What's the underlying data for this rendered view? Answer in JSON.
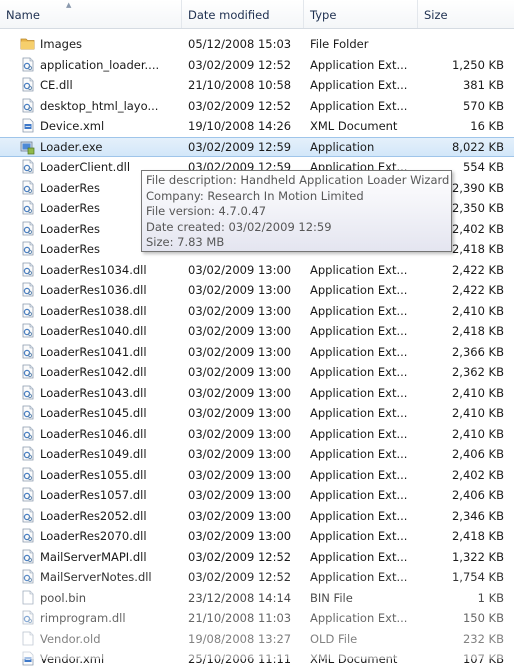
{
  "columns": {
    "name": "Name",
    "date": "Date modified",
    "type": "Type",
    "size": "Size"
  },
  "files": [
    {
      "icon": "folder-icon",
      "name": "Images",
      "date": "05/12/2008 15:03",
      "type": "File Folder",
      "size": ""
    },
    {
      "icon": "dll-icon",
      "name": "application_loader....",
      "date": "03/02/2009 12:52",
      "type": "Application Ext...",
      "size": "1,250 KB"
    },
    {
      "icon": "dll-icon",
      "name": "CE.dll",
      "date": "21/10/2008 10:58",
      "type": "Application Ext...",
      "size": "381 KB"
    },
    {
      "icon": "dll-icon",
      "name": "desktop_html_layo...",
      "date": "03/02/2009 12:52",
      "type": "Application Ext...",
      "size": "570 KB"
    },
    {
      "icon": "xml-icon",
      "name": "Device.xml",
      "date": "19/10/2008 14:26",
      "type": "XML Document",
      "size": "16 KB"
    },
    {
      "icon": "exe-icon",
      "name": "Loader.exe",
      "date": "03/02/2009 12:59",
      "type": "Application",
      "size": "8,022 KB"
    },
    {
      "icon": "dll-icon",
      "name": "LoaderClient.dll",
      "date": "03/02/2009 12:59",
      "type": "Application Ext...",
      "size": "554 KB"
    },
    {
      "icon": "dll-icon",
      "name": "LoaderRes",
      "date": "",
      "type": "",
      "size": "2,390 KB"
    },
    {
      "icon": "dll-icon",
      "name": "LoaderRes",
      "date": "",
      "type": "",
      "size": "2,350 KB"
    },
    {
      "icon": "dll-icon",
      "name": "LoaderRes",
      "date": "",
      "type": "",
      "size": "2,402 KB"
    },
    {
      "icon": "dll-icon",
      "name": "LoaderRes",
      "date": "",
      "type": "",
      "size": "2,418 KB"
    },
    {
      "icon": "dll-icon",
      "name": "LoaderRes1034.dll",
      "date": "03/02/2009 13:00",
      "type": "Application Ext...",
      "size": "2,422 KB"
    },
    {
      "icon": "dll-icon",
      "name": "LoaderRes1036.dll",
      "date": "03/02/2009 13:00",
      "type": "Application Ext...",
      "size": "2,422 KB"
    },
    {
      "icon": "dll-icon",
      "name": "LoaderRes1038.dll",
      "date": "03/02/2009 13:00",
      "type": "Application Ext...",
      "size": "2,410 KB"
    },
    {
      "icon": "dll-icon",
      "name": "LoaderRes1040.dll",
      "date": "03/02/2009 13:00",
      "type": "Application Ext...",
      "size": "2,418 KB"
    },
    {
      "icon": "dll-icon",
      "name": "LoaderRes1041.dll",
      "date": "03/02/2009 13:00",
      "type": "Application Ext...",
      "size": "2,366 KB"
    },
    {
      "icon": "dll-icon",
      "name": "LoaderRes1042.dll",
      "date": "03/02/2009 13:00",
      "type": "Application Ext...",
      "size": "2,362 KB"
    },
    {
      "icon": "dll-icon",
      "name": "LoaderRes1043.dll",
      "date": "03/02/2009 13:00",
      "type": "Application Ext...",
      "size": "2,410 KB"
    },
    {
      "icon": "dll-icon",
      "name": "LoaderRes1045.dll",
      "date": "03/02/2009 13:00",
      "type": "Application Ext...",
      "size": "2,410 KB"
    },
    {
      "icon": "dll-icon",
      "name": "LoaderRes1046.dll",
      "date": "03/02/2009 13:00",
      "type": "Application Ext...",
      "size": "2,410 KB"
    },
    {
      "icon": "dll-icon",
      "name": "LoaderRes1049.dll",
      "date": "03/02/2009 13:00",
      "type": "Application Ext...",
      "size": "2,406 KB"
    },
    {
      "icon": "dll-icon",
      "name": "LoaderRes1055.dll",
      "date": "03/02/2009 13:00",
      "type": "Application Ext...",
      "size": "2,402 KB"
    },
    {
      "icon": "dll-icon",
      "name": "LoaderRes1057.dll",
      "date": "03/02/2009 13:00",
      "type": "Application Ext...",
      "size": "2,406 KB"
    },
    {
      "icon": "dll-icon",
      "name": "LoaderRes2052.dll",
      "date": "03/02/2009 13:00",
      "type": "Application Ext...",
      "size": "2,346 KB"
    },
    {
      "icon": "dll-icon",
      "name": "LoaderRes2070.dll",
      "date": "03/02/2009 13:00",
      "type": "Application Ext...",
      "size": "2,418 KB"
    },
    {
      "icon": "dll-icon",
      "name": "MailServerMAPI.dll",
      "date": "03/02/2009 12:52",
      "type": "Application Ext...",
      "size": "1,322 KB"
    },
    {
      "icon": "dll-icon",
      "name": "MailServerNotes.dll",
      "date": "03/02/2009 12:52",
      "type": "Application Ext...",
      "size": "1,754 KB"
    },
    {
      "icon": "generic-file-icon",
      "name": "pool.bin",
      "date": "23/12/2008 14:14",
      "type": "BIN File",
      "size": "1 KB"
    },
    {
      "icon": "dll-icon",
      "name": "rimprogram.dll",
      "date": "21/10/2008 11:03",
      "type": "Application Ext...",
      "size": "150 KB"
    },
    {
      "icon": "generic-file-icon",
      "name": "Vendor.old",
      "date": "19/08/2008 13:27",
      "type": "OLD File",
      "size": "232 KB"
    },
    {
      "icon": "xml-icon",
      "name": "Vendor.xml",
      "date": "25/10/2006 11:11",
      "type": "XML Document",
      "size": "107 KB"
    }
  ],
  "selected_index": 5,
  "tooltip": {
    "description": "File description: Handheld Application Loader Wizard",
    "company": "Company: Research In Motion Limited",
    "version": "File version: 4.7.0.47",
    "created": "Date created: 03/02/2009 12:59",
    "size": "Size: 7.83 MB"
  },
  "colors": {
    "selection_bg": "#d9eaf9",
    "selection_border": "#9fc5ea",
    "header_text": "#1e3050",
    "tooltip_text": "#575757"
  }
}
